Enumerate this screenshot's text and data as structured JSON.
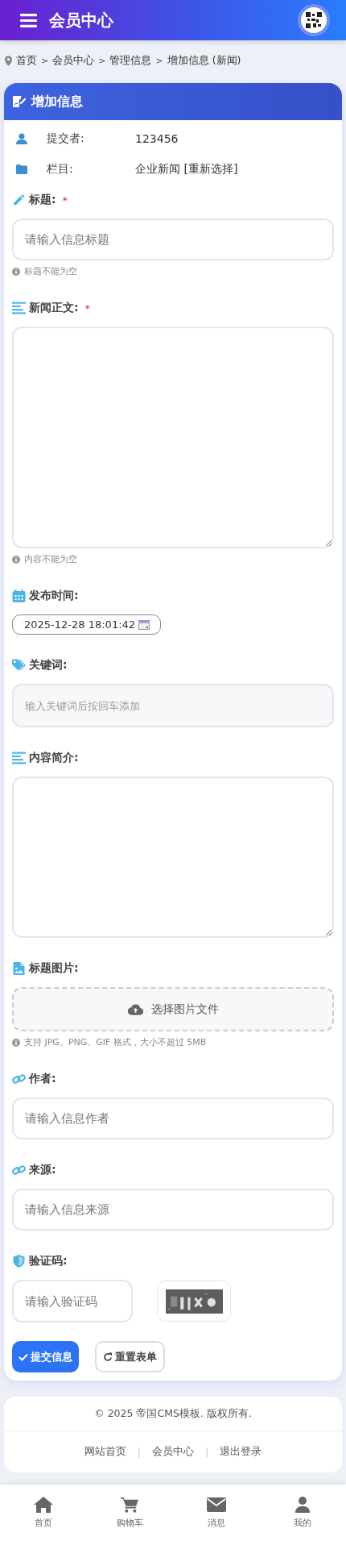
{
  "header": {
    "title": "会员中心"
  },
  "breadcrumb": [
    {
      "text": "首页",
      "kind": "link"
    },
    {
      "text": ">",
      "kind": "separator"
    },
    {
      "text": "会员中心",
      "kind": "link"
    },
    {
      "text": ">",
      "kind": "separator"
    },
    {
      "text": "管理信息",
      "kind": "link"
    },
    {
      "text": ">",
      "kind": "separator"
    },
    {
      "text": "增加信息 (新闻)",
      "kind": "current"
    }
  ],
  "card": {
    "title": "增加信息",
    "info_rows": [
      {
        "label": "提交者:",
        "value": "123456"
      },
      {
        "label": "栏目:",
        "value": "企业新闻 [重新选择]"
      }
    ],
    "fields": [
      {
        "kind": "text",
        "label": "标题:",
        "required_mark": "*",
        "placeholder": "请输入信息标题",
        "hint": "标题不能为空"
      },
      {
        "kind": "textarea",
        "label": "新闻正文:",
        "required_mark": "*",
        "hint": "内容不能为空"
      },
      {
        "kind": "date",
        "label": "发布时间:",
        "value": "2025-12-28 18:01:42"
      },
      {
        "kind": "tags",
        "label": "关键词:",
        "placeholder": "输入关键词后按回车添加"
      },
      {
        "kind": "textarea",
        "label": "内容简介:"
      },
      {
        "kind": "upload",
        "label": "标题图片:",
        "button": "选择图片文件",
        "hint": "支持 JPG、PNG、GIF 格式，大小不超过 5MB"
      },
      {
        "kind": "text",
        "label": "作者:",
        "placeholder": "请输入信息作者"
      },
      {
        "kind": "text",
        "label": "来源:",
        "placeholder": "请输入信息来源"
      },
      {
        "kind": "captcha",
        "label": "验证码:",
        "placeholder": "请输入验证码"
      }
    ],
    "buttons": [
      {
        "kind": "primary",
        "label": "提交信息"
      },
      {
        "kind": "secondary",
        "label": "重置表单"
      }
    ]
  },
  "footer": {
    "copyright": "© 2025 帝国CMS模板. 版权所有.",
    "links": [
      {
        "text": "网站首页",
        "kind": "link"
      },
      {
        "text": "|",
        "kind": "separator"
      },
      {
        "text": "会员中心",
        "kind": "link"
      },
      {
        "text": "|",
        "kind": "separator"
      },
      {
        "text": "退出登录",
        "kind": "link"
      }
    ]
  },
  "bottom_nav": [
    {
      "label": "首页"
    },
    {
      "label": "购物车"
    },
    {
      "label": "消息"
    },
    {
      "label": "我的"
    }
  ]
}
